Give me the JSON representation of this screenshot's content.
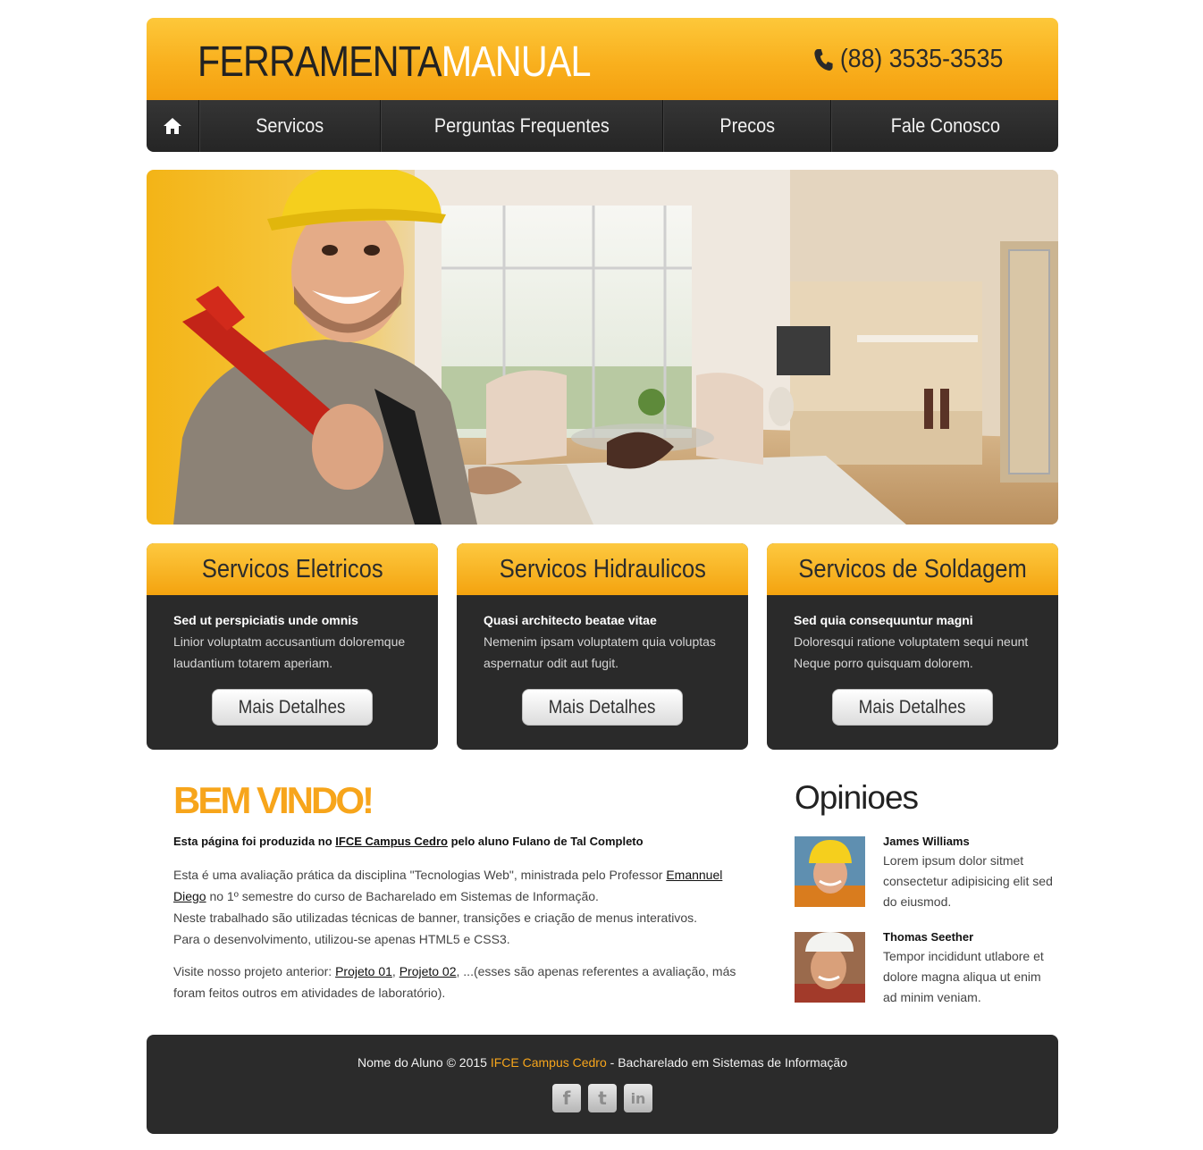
{
  "header": {
    "logo_part1": "FERRAMENTA",
    "logo_part2": "MANUAL",
    "phone": "(88) 3535-3535",
    "phone_icon": "phone-icon"
  },
  "nav": {
    "home_icon": "home-icon",
    "items": [
      {
        "label": "Servicos"
      },
      {
        "label": "Perguntas Frequentes"
      },
      {
        "label": "Precos"
      },
      {
        "label": "Fale Conosco"
      }
    ]
  },
  "services": [
    {
      "title": "Servicos Eletricos",
      "subtitle": "Sed ut perspiciatis unde omnis",
      "text": "Linior voluptatm accusantium doloremque laudantium totarem aperiam.",
      "button": "Mais Detalhes"
    },
    {
      "title": "Servicos Hidraulicos",
      "subtitle": "Quasi architecto beatae vitae",
      "text": "Nemenim ipsam voluptatem quia voluptas aspernatur odit aut fugit.",
      "button": "Mais Detalhes"
    },
    {
      "title": "Servicos de Soldagem",
      "subtitle": "Sed quia consequuntur magni",
      "text": "Doloresqui ratione voluptatem sequi neunt Neque porro quisquam dolorem.",
      "button": "Mais Detalhes"
    }
  ],
  "welcome": {
    "heading": "BEM VINDO!",
    "lead_a": "Esta página foi produzida no ",
    "lead_link": "IFCE Campus Cedro",
    "lead_b": " pelo aluno Fulano de Tal Completo",
    "p1_a": "Esta é uma avaliação prática da disciplina \"Tecnologias Web\", ministrada pelo Professor ",
    "p1_link": "Emannuel Diego",
    "p1_b": " no 1º semestre do curso de Bacharelado em Sistemas de Informação.",
    "p2": "Neste trabalhado são utilizadas técnicas de banner, transições e criação de menus interativos.",
    "p3": "Para o desenvolvimento, utilizou-se apenas HTML5 e CSS3.",
    "p4_a": "Visite nosso projeto anterior: ",
    "p4_link1": "Projeto 01",
    "p4_sep": ", ",
    "p4_link2": "Projeto 02",
    "p4_b": ", ...(esses são apenas referentes a avaliação, más foram feitos outros em atividades de laboratório)."
  },
  "opinions": {
    "heading": "Opinioes",
    "items": [
      {
        "name": "James Williams",
        "text": "Lorem ipsum dolor sitmet consectetur adipisicing elit sed do eiusmod."
      },
      {
        "name": "Thomas Seether",
        "text": "Tempor incididunt utlabore et dolore magna aliqua ut enim ad minim veniam."
      }
    ]
  },
  "footer": {
    "text_a": "Nome do Aluno © 2015 ",
    "text_link": "IFCE Campus Cedro",
    "text_b": " - Bacharelado em Sistemas de Informação",
    "social": [
      "facebook-icon",
      "twitter-icon",
      "linkedin-icon"
    ]
  },
  "colors": {
    "accent": "#f7a51b",
    "dark": "#2b2b2b"
  }
}
